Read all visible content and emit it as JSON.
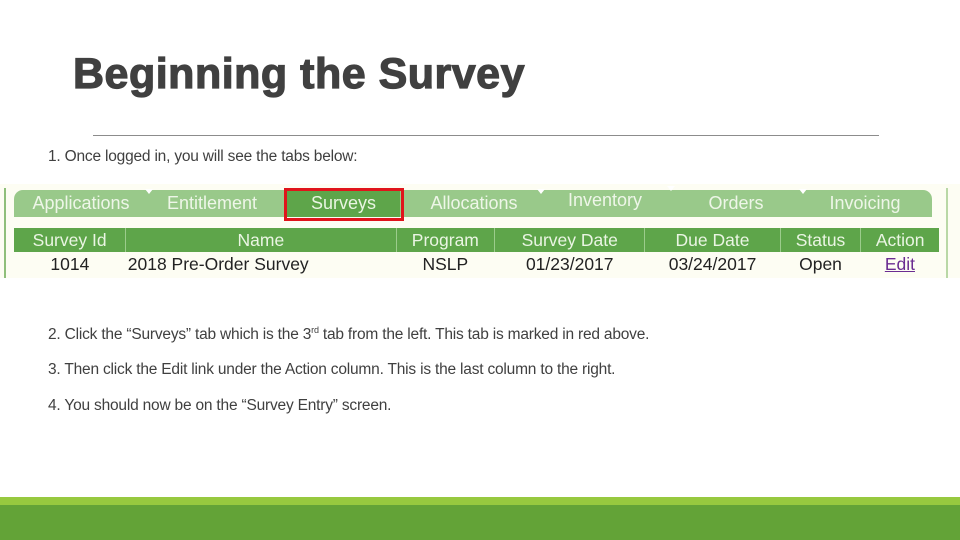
{
  "slide": {
    "title": "Beginning the Survey",
    "steps": {
      "step1": "1. Once logged in, you will see the tabs below:",
      "step2_pre": "2. Click the “Surveys” tab which is the 3",
      "step2_sup": "rd",
      "step2_post": " tab from the left. This tab is marked in red above.",
      "step3": "3. Then click the Edit link under the Action column. This is the last column to the right.",
      "step4": "4. You should now be on the “Survey Entry” screen."
    }
  },
  "screenshot": {
    "tabs": [
      {
        "label": "Applications",
        "active": false
      },
      {
        "label": "Entitlement",
        "active": false
      },
      {
        "label": "Surveys",
        "active": true
      },
      {
        "label": "Allocations",
        "active": false
      },
      {
        "label": "Inventory",
        "active": false
      },
      {
        "label": "Orders",
        "active": false
      },
      {
        "label": "Invoicing",
        "active": false
      }
    ],
    "highlight_color": "#e0141b",
    "table": {
      "columns": [
        "Survey Id",
        "Name",
        "Program",
        "Survey Date",
        "Due Date",
        "Status",
        "Action"
      ],
      "rows": [
        {
          "survey_id": "1014",
          "name": "2018 Pre-Order Survey",
          "program": "NSLP",
          "survey_date": "01/23/2017",
          "due_date": "03/24/2017",
          "status": "Open",
          "action": "Edit"
        }
      ]
    }
  },
  "colors": {
    "tab_bg": "#99c98a",
    "active_tab": "#5ea54a",
    "header_bg": "#5ea54a",
    "link": "#6a2c91",
    "footer_light": "#97c93f",
    "footer_dark": "#63a337"
  }
}
